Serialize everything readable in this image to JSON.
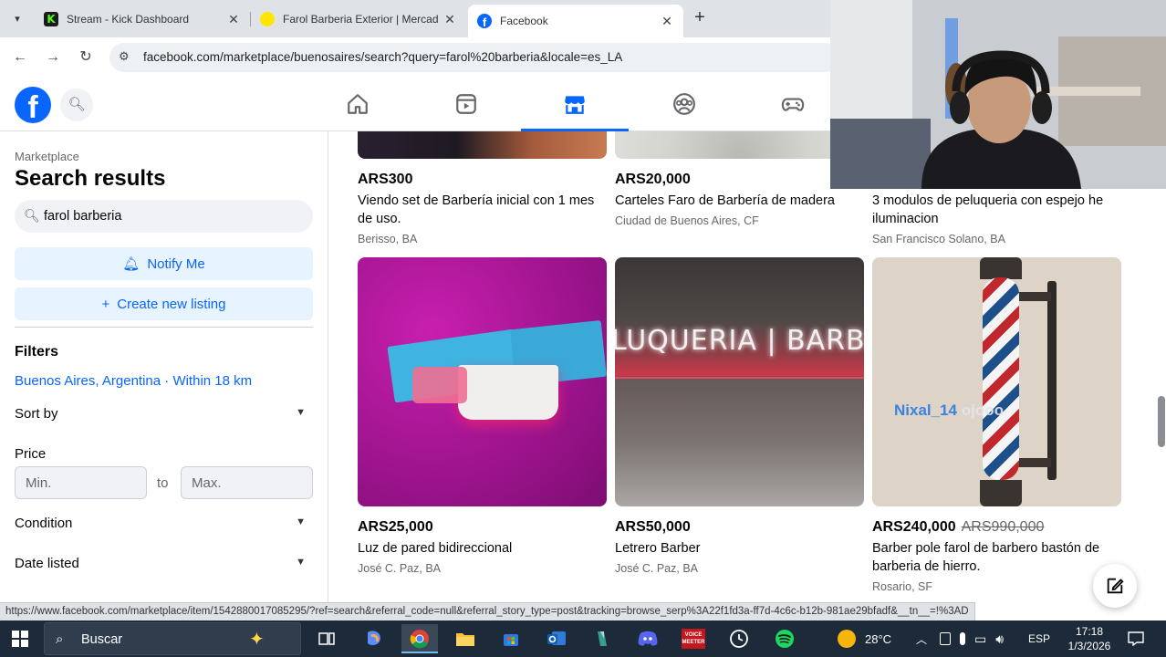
{
  "browser": {
    "tabs": [
      {
        "title": "Stream - Kick Dashboard",
        "color": "#53fc18"
      },
      {
        "title": "Farol Barberia Exterior | Mercad",
        "color": "#ffe600"
      },
      {
        "title": "Facebook",
        "color": "#0866ff"
      }
    ],
    "url": "facebook.com/marketplace/buenosaires/search?query=farol%20barberia&locale=es_LA",
    "status_url": "https://www.facebook.com/marketplace/item/1542880017085295/?ref=search&referral_code=null&referral_story_type=post&tracking=browse_serp%3A22f1fd3a-ff7d-4c6c-b12b-981ae29bfadf&__tn__=!%3AD"
  },
  "fb": {
    "logo_letter": "f",
    "accent": "#0866ff"
  },
  "sidebar": {
    "crumb": "Marketplace",
    "title": "Search results",
    "search_value": "farol barberia",
    "notify": "Notify Me",
    "create": "Create new listing",
    "filters_heading": "Filters",
    "location": "Buenos Aires, Argentina · Within 18 km",
    "sort_by": "Sort by",
    "price_heading": "Price",
    "price_min": "Min.",
    "price_to": "to",
    "price_max": "Max.",
    "condition": "Condition",
    "date_listed": "Date listed"
  },
  "listings_top": [
    {
      "price": "ARS300",
      "name": "Viendo set de Barbería inicial con 1 mes de uso.",
      "loc": "Berisso, BA"
    },
    {
      "price": "ARS20,000",
      "name": "Carteles Faro de Barbería de madera",
      "loc": "Ciudad de Buenos Aires, CF"
    },
    {
      "price": "",
      "name": "3 modulos de peluqueria con espejo he iluminacion",
      "loc": "San Francisco Solano, BA"
    }
  ],
  "listings": [
    {
      "price": "ARS25,000",
      "old_price": "",
      "name": "Luz de pared bidireccional",
      "loc": "José C. Paz, BA"
    },
    {
      "price": "ARS50,000",
      "old_price": "",
      "name": "Letrero Barber",
      "loc": "José C. Paz, BA",
      "sign_text": "LUQUERIA | BARBER"
    },
    {
      "price": "ARS240,000",
      "old_price": "ARS990,000",
      "name": "Barber pole farol de barbero bastón de barberia de hierro.",
      "loc": "Rosario, SF"
    }
  ],
  "overlay": {
    "name": "Nixal_14",
    "suffix": "ojooo"
  },
  "taskbar": {
    "search": "Buscar",
    "temp": "28°C",
    "lang": "ESP",
    "time": "17:18",
    "date": "1/3/2026",
    "voicemeeter": "VOICE MEETER"
  }
}
